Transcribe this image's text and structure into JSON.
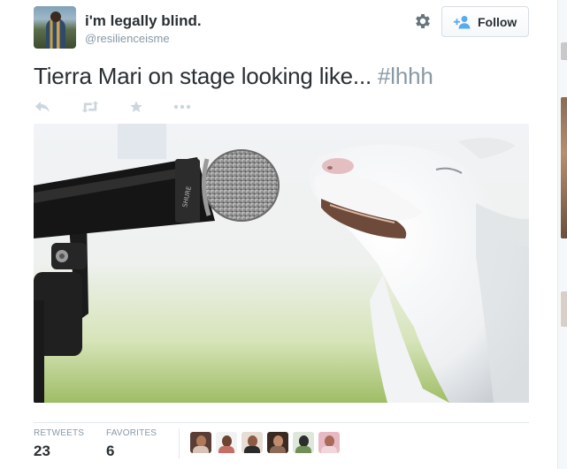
{
  "tweet": {
    "author": {
      "name": "i'm legally blind.",
      "handle": "@resilienceisme",
      "avatar_icon": "user-avatar"
    },
    "text": "Tierra Mari on stage looking like...",
    "hashtag": "#lhhh",
    "follow_button": {
      "label": "Follow",
      "icon": "add-user-icon"
    },
    "settings_icon": "gear-icon",
    "actions": [
      "reply-icon",
      "retweet-icon",
      "favorite-icon",
      "more-icon"
    ],
    "media_description_icon": "photo-goat-microphone",
    "stats": {
      "retweets_label": "RETWEETS",
      "retweets_count": "23",
      "favorites_label": "FAVORITES",
      "favorites_count": "6"
    },
    "favoriters_count": 6
  },
  "colors": {
    "text": "#292f33",
    "muted": "#8899a6",
    "border": "#e1e8ed",
    "action_icon": "#ccd6dd",
    "follow_icon": "#55acee"
  }
}
